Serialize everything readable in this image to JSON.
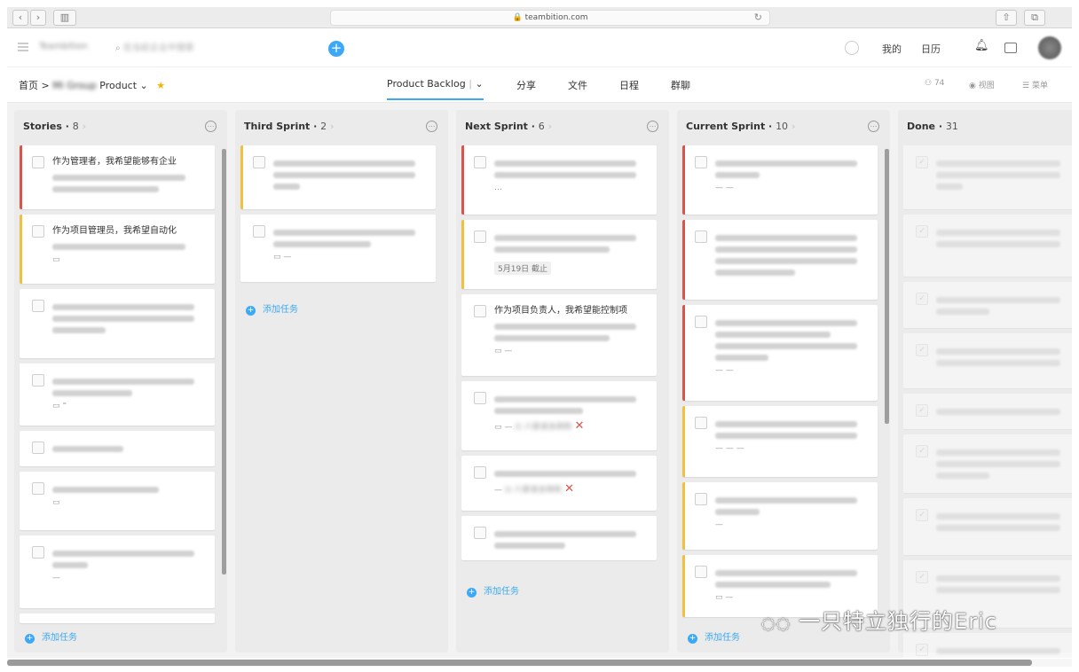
{
  "browser": {
    "url": "teambition.com",
    "lock_icon": "lock-icon",
    "nav_back": "‹",
    "nav_forward": "›"
  },
  "app": {
    "logo_text": "Teambition",
    "search_placeholder": "在当前企业中搜索",
    "my_label": "我的",
    "calendar_label": "日历"
  },
  "nav": {
    "home": "首页",
    "separator": ">",
    "project_prefix": "Mi Group",
    "project": "Product",
    "tabs": [
      {
        "label": "Product Backlog"
      },
      {
        "label": "分享"
      },
      {
        "label": "文件"
      },
      {
        "label": "日程"
      },
      {
        "label": "群聊"
      }
    ],
    "members_count": "74",
    "view_label": "视图",
    "menu_label": "菜单"
  },
  "columns": [
    {
      "title": "Stories",
      "count": "8"
    },
    {
      "title": "Third Sprint",
      "count": "2"
    },
    {
      "title": "Next Sprint",
      "count": "6"
    },
    {
      "title": "Current Sprint",
      "count": "10"
    },
    {
      "title": "Done",
      "count": "31"
    }
  ],
  "cards": {
    "stories_1": "作为管理者，我希望能够有企业",
    "stories_2": "作为项目管理员，我希望自动化",
    "next_3": "作为项目负责人，我希望能控制项",
    "next_2_date": "5月19日 截止"
  },
  "add_task": "添加任务",
  "watermark": "一只特立独行的Eric",
  "colors": {
    "accent": "#3da8f5",
    "red": "#d9534f",
    "yellow": "#f0c040"
  }
}
